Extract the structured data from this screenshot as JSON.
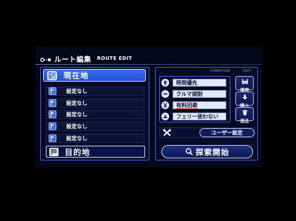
{
  "colors": {
    "accent": "#1f4fd6",
    "panel_border": "#3b63dd",
    "background": "#05071a",
    "active_underline": "#e02020"
  },
  "header": {
    "icon": "route-icon",
    "title_ja": "ルート編集",
    "title_en": "ROUTE EDIT"
  },
  "route": {
    "start": {
      "label": "現在地",
      "icon": "start-flag-icon"
    },
    "waypoints": [
      {
        "label": "設定なし",
        "icon": "waypoint-flag-icon"
      },
      {
        "label": "設定なし",
        "icon": "waypoint-flag-icon"
      },
      {
        "label": "設定なし",
        "icon": "waypoint-flag-icon"
      },
      {
        "label": "設定なし",
        "icon": "waypoint-flag-icon"
      },
      {
        "label": "設定なし",
        "icon": "waypoint-flag-icon"
      }
    ],
    "destination": {
      "label": "目的地",
      "icon": "checkered-flag-icon"
    }
  },
  "conditions": {
    "header": "CONDITION",
    "items": [
      {
        "label": "時間優先",
        "icon": "up-arrow-icon",
        "active": false
      },
      {
        "label": "クルマ規制",
        "icon": "minus-icon",
        "active": false
      },
      {
        "label": "有料回避",
        "icon": "yen-icon",
        "active": true
      },
      {
        "label": "フェリー使わない",
        "icon": "ferry-icon",
        "active": false
      }
    ]
  },
  "edit": {
    "header": "EDIT",
    "save": "保存",
    "insert": "挿入",
    "delete": "消去"
  },
  "user_settings": {
    "label": "ユーザー設定",
    "icon": "tools-icon"
  },
  "search": {
    "label": "探索開始",
    "icon": "search-icon"
  }
}
